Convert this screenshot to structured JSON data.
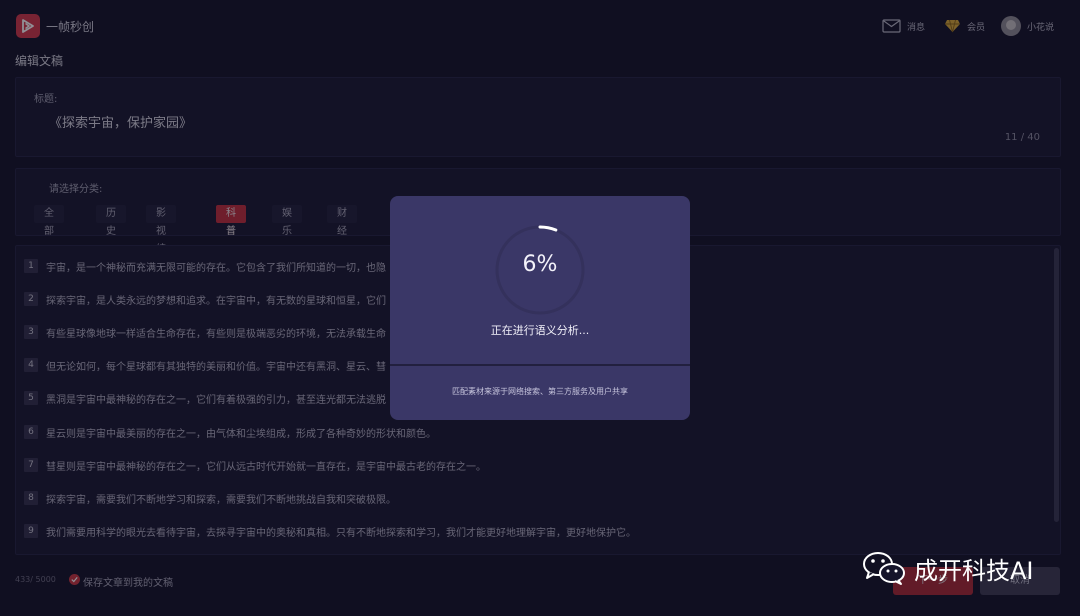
{
  "app": {
    "name": "一帧秒创"
  },
  "nav": {
    "messages": "消息",
    "membership": "会员",
    "user": "小花说"
  },
  "editor": {
    "section_title": "编辑文稿",
    "title_label": "标题:",
    "title_value": "《探索宇宙，保护家园》",
    "title_count": "11 / 40"
  },
  "category": {
    "label": "请选择分类:",
    "items": [
      "全部",
      "历史",
      "影视综艺",
      "科普",
      "娱乐",
      "财经"
    ],
    "active": "科普"
  },
  "content": {
    "lines": [
      {
        "n": "1",
        "text": "宇宙，是一个神秘而充满无限可能的存在。它包含了我们所知道的一切，也隐"
      },
      {
        "n": "2",
        "text": "探索宇宙，是人类永远的梦想和追求。在宇宙中，有无数的星球和恒星，它们"
      },
      {
        "n": "3",
        "text": "有些星球像地球一样适合生命存在，有些则是极端恶劣的环境，无法承载生命"
      },
      {
        "n": "4",
        "text": "但无论如何，每个星球都有其独特的美丽和价值。宇宙中还有黑洞、星云、彗"
      },
      {
        "n": "5",
        "text": "黑洞是宇宙中最神秘的存在之一，它们有着极强的引力，甚至连光都无法逃脱"
      },
      {
        "n": "6",
        "text": "星云则是宇宙中最美丽的存在之一，由气体和尘埃组成，形成了各种奇妙的形状和颜色。"
      },
      {
        "n": "7",
        "text": "彗星则是宇宙中最神秘的存在之一，它们从远古时代开始就一直存在，是宇宙中最古老的存在之一。"
      },
      {
        "n": "8",
        "text": "探索宇宙，需要我们不断地学习和探索，需要我们不断地挑战自我和突破极限。"
      },
      {
        "n": "9",
        "text": "我们需要用科学的眼光去看待宇宙，去探寻宇宙中的奥秘和真相。只有不断地探索和学习，我们才能更好地理解宇宙，更好地保护它。"
      }
    ]
  },
  "footer": {
    "count": "433/ 5000",
    "save_label": "保存文章到我的文稿",
    "next": "下一步",
    "cancel": "取消"
  },
  "modal": {
    "progress_percent": 6,
    "percent_text": "6%",
    "status": "正在进行语义分析...",
    "note": "匹配素材来源于网络搜索、第三方服务及用户共享"
  },
  "watermark": {
    "text": "成开科技AI"
  },
  "colors": {
    "accent": "#c2303f",
    "background": "#15142a",
    "modal": "#3a3767"
  }
}
